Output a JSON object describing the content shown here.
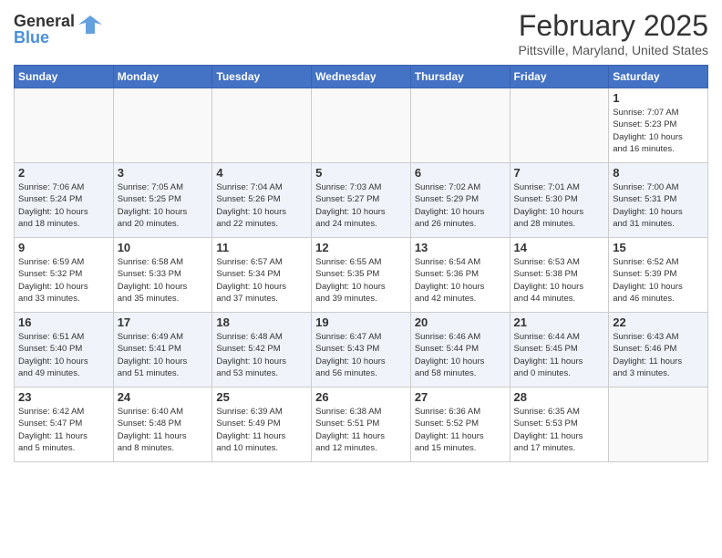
{
  "header": {
    "logo": {
      "general": "General",
      "blue": "Blue"
    },
    "title": "February 2025",
    "subtitle": "Pittsville, Maryland, United States"
  },
  "calendar": {
    "days_of_week": [
      "Sunday",
      "Monday",
      "Tuesday",
      "Wednesday",
      "Thursday",
      "Friday",
      "Saturday"
    ],
    "weeks": [
      [
        {
          "day": "",
          "info": ""
        },
        {
          "day": "",
          "info": ""
        },
        {
          "day": "",
          "info": ""
        },
        {
          "day": "",
          "info": ""
        },
        {
          "day": "",
          "info": ""
        },
        {
          "day": "",
          "info": ""
        },
        {
          "day": "1",
          "info": "Sunrise: 7:07 AM\nSunset: 5:23 PM\nDaylight: 10 hours\nand 16 minutes."
        }
      ],
      [
        {
          "day": "2",
          "info": "Sunrise: 7:06 AM\nSunset: 5:24 PM\nDaylight: 10 hours\nand 18 minutes."
        },
        {
          "day": "3",
          "info": "Sunrise: 7:05 AM\nSunset: 5:25 PM\nDaylight: 10 hours\nand 20 minutes."
        },
        {
          "day": "4",
          "info": "Sunrise: 7:04 AM\nSunset: 5:26 PM\nDaylight: 10 hours\nand 22 minutes."
        },
        {
          "day": "5",
          "info": "Sunrise: 7:03 AM\nSunset: 5:27 PM\nDaylight: 10 hours\nand 24 minutes."
        },
        {
          "day": "6",
          "info": "Sunrise: 7:02 AM\nSunset: 5:29 PM\nDaylight: 10 hours\nand 26 minutes."
        },
        {
          "day": "7",
          "info": "Sunrise: 7:01 AM\nSunset: 5:30 PM\nDaylight: 10 hours\nand 28 minutes."
        },
        {
          "day": "8",
          "info": "Sunrise: 7:00 AM\nSunset: 5:31 PM\nDaylight: 10 hours\nand 31 minutes."
        }
      ],
      [
        {
          "day": "9",
          "info": "Sunrise: 6:59 AM\nSunset: 5:32 PM\nDaylight: 10 hours\nand 33 minutes."
        },
        {
          "day": "10",
          "info": "Sunrise: 6:58 AM\nSunset: 5:33 PM\nDaylight: 10 hours\nand 35 minutes."
        },
        {
          "day": "11",
          "info": "Sunrise: 6:57 AM\nSunset: 5:34 PM\nDaylight: 10 hours\nand 37 minutes."
        },
        {
          "day": "12",
          "info": "Sunrise: 6:55 AM\nSunset: 5:35 PM\nDaylight: 10 hours\nand 39 minutes."
        },
        {
          "day": "13",
          "info": "Sunrise: 6:54 AM\nSunset: 5:36 PM\nDaylight: 10 hours\nand 42 minutes."
        },
        {
          "day": "14",
          "info": "Sunrise: 6:53 AM\nSunset: 5:38 PM\nDaylight: 10 hours\nand 44 minutes."
        },
        {
          "day": "15",
          "info": "Sunrise: 6:52 AM\nSunset: 5:39 PM\nDaylight: 10 hours\nand 46 minutes."
        }
      ],
      [
        {
          "day": "16",
          "info": "Sunrise: 6:51 AM\nSunset: 5:40 PM\nDaylight: 10 hours\nand 49 minutes."
        },
        {
          "day": "17",
          "info": "Sunrise: 6:49 AM\nSunset: 5:41 PM\nDaylight: 10 hours\nand 51 minutes."
        },
        {
          "day": "18",
          "info": "Sunrise: 6:48 AM\nSunset: 5:42 PM\nDaylight: 10 hours\nand 53 minutes."
        },
        {
          "day": "19",
          "info": "Sunrise: 6:47 AM\nSunset: 5:43 PM\nDaylight: 10 hours\nand 56 minutes."
        },
        {
          "day": "20",
          "info": "Sunrise: 6:46 AM\nSunset: 5:44 PM\nDaylight: 10 hours\nand 58 minutes."
        },
        {
          "day": "21",
          "info": "Sunrise: 6:44 AM\nSunset: 5:45 PM\nDaylight: 11 hours\nand 0 minutes."
        },
        {
          "day": "22",
          "info": "Sunrise: 6:43 AM\nSunset: 5:46 PM\nDaylight: 11 hours\nand 3 minutes."
        }
      ],
      [
        {
          "day": "23",
          "info": "Sunrise: 6:42 AM\nSunset: 5:47 PM\nDaylight: 11 hours\nand 5 minutes."
        },
        {
          "day": "24",
          "info": "Sunrise: 6:40 AM\nSunset: 5:48 PM\nDaylight: 11 hours\nand 8 minutes."
        },
        {
          "day": "25",
          "info": "Sunrise: 6:39 AM\nSunset: 5:49 PM\nDaylight: 11 hours\nand 10 minutes."
        },
        {
          "day": "26",
          "info": "Sunrise: 6:38 AM\nSunset: 5:51 PM\nDaylight: 11 hours\nand 12 minutes."
        },
        {
          "day": "27",
          "info": "Sunrise: 6:36 AM\nSunset: 5:52 PM\nDaylight: 11 hours\nand 15 minutes."
        },
        {
          "day": "28",
          "info": "Sunrise: 6:35 AM\nSunset: 5:53 PM\nDaylight: 11 hours\nand 17 minutes."
        },
        {
          "day": "",
          "info": ""
        }
      ]
    ]
  }
}
